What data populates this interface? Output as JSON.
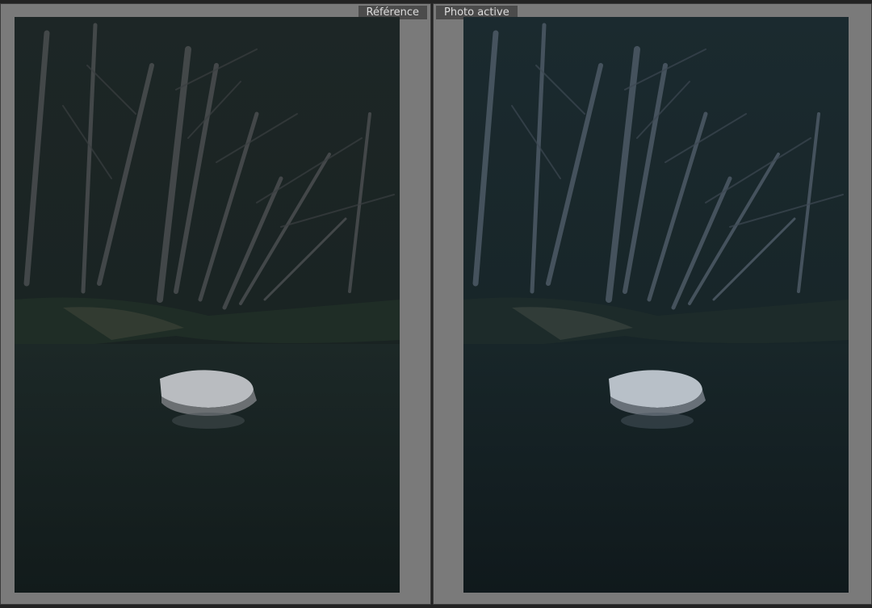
{
  "compare_view": {
    "reference": {
      "label": "Référence",
      "photo_description_icon": "forest-river-rock-photo"
    },
    "active": {
      "label": "Photo active",
      "photo_description_icon": "forest-river-rock-photo"
    }
  },
  "colors": {
    "panel_background": "#7a7a7a",
    "label_background": "#4b4b4b",
    "label_text": "#dcdcdc",
    "reference_tone": "#1f2a2a",
    "active_tone": "#1a2a2e"
  }
}
